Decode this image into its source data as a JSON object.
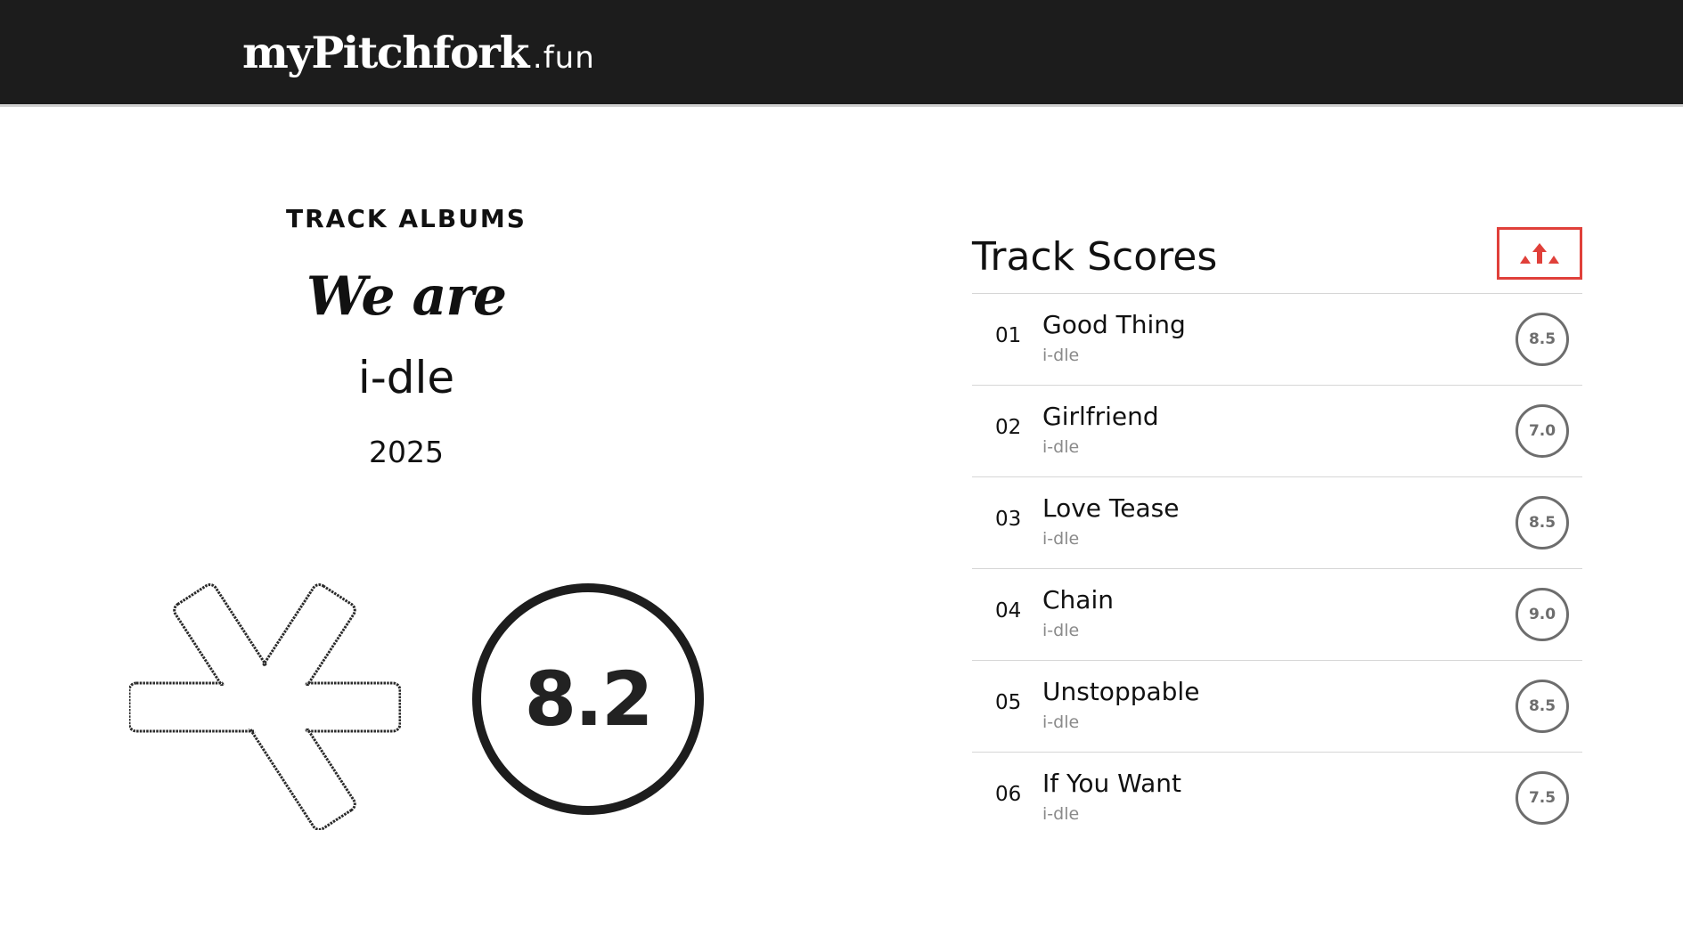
{
  "brand": {
    "name": "myPitchfork",
    "tld": ".fun"
  },
  "album": {
    "eyebrow": "TRACK ALBUMS",
    "title": "We are",
    "artist": "i-dle",
    "year": "2025",
    "score": "8.2"
  },
  "panel": {
    "title": "Track Scores",
    "sort_icon": "sort-up-arrows-icon",
    "accent_color": "#e0403a"
  },
  "tracks": [
    {
      "num": "01",
      "title": "Good Thing",
      "artist": "i-dle",
      "score": "8.5"
    },
    {
      "num": "02",
      "title": "Girlfriend",
      "artist": "i-dle",
      "score": "7.0"
    },
    {
      "num": "03",
      "title": "Love Tease",
      "artist": "i-dle",
      "score": "8.5"
    },
    {
      "num": "04",
      "title": "Chain",
      "artist": "i-dle",
      "score": "9.0"
    },
    {
      "num": "05",
      "title": "Unstoppable",
      "artist": "i-dle",
      "score": "8.5"
    },
    {
      "num": "06",
      "title": "If You Want",
      "artist": "i-dle",
      "score": "7.5"
    }
  ]
}
